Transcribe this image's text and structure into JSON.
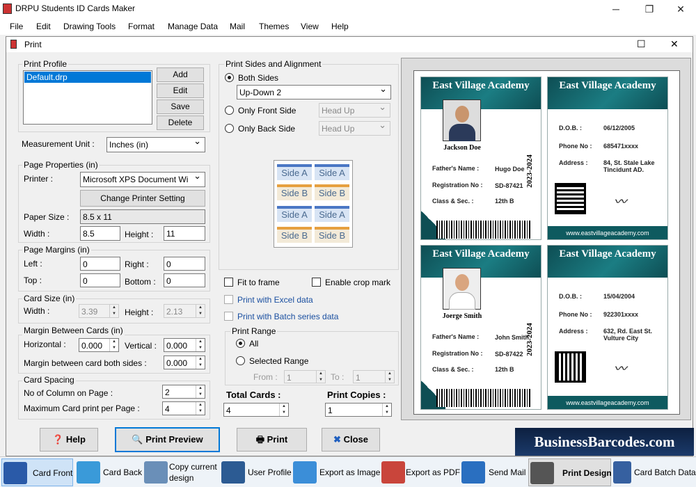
{
  "app": {
    "title": "DRPU Students ID Cards Maker",
    "minimize": "─",
    "maximize": "❐",
    "close": "✕"
  },
  "menu": [
    "File",
    "Edit",
    "Drawing Tools",
    "Format",
    "Manage Data",
    "Mail",
    "Themes",
    "View",
    "Help"
  ],
  "dialog": {
    "title": "Print",
    "maximize": "☐",
    "close": "✕"
  },
  "print_profile": {
    "label": "Print Profile",
    "items": [
      "Default.drp"
    ],
    "buttons": {
      "add": "Add",
      "edit": "Edit",
      "save": "Save",
      "delete": "Delete"
    }
  },
  "measurement": {
    "label": "Measurement Unit :",
    "value": "Inches (in)"
  },
  "page_properties": {
    "label": "Page Properties (in)",
    "printer_label": "Printer :",
    "printer_value": "Microsoft XPS Document Wi",
    "change_printer": "Change Printer Setting",
    "paper_size_label": "Paper Size :",
    "paper_size_value": "8.5 x 11",
    "width_label": "Width :",
    "width_value": "8.5",
    "height_label": "Height :",
    "height_value": "11"
  },
  "page_margins": {
    "label": "Page Margins (in)",
    "left_label": "Left :",
    "left_value": "0",
    "right_label": "Right :",
    "right_value": "0",
    "top_label": "Top :",
    "top_value": "0",
    "bottom_label": "Bottom :",
    "bottom_value": "0"
  },
  "card_size": {
    "label": "Card Size (in)",
    "width_label": "Width :",
    "width_value": "3.39",
    "height_label": "Height :",
    "height_value": "2.13"
  },
  "margin_between": {
    "label": "Margin Between Cards (in)",
    "horizontal_label": "Horizontal :",
    "horizontal_value": "0.000",
    "vertical_label": "Vertical :",
    "vertical_value": "0.000",
    "both_label": "Margin between card both sides :",
    "both_value": "0.000"
  },
  "card_spacing": {
    "label": "Card Spacing",
    "columns_label": "No of Column on Page :",
    "columns_value": "2",
    "max_label": "Maximum Card print per Page :",
    "max_value": "4"
  },
  "print_sides": {
    "label": "Print Sides and Alignment",
    "both": "Both Sides",
    "both_select": "Up-Down 2",
    "front": "Only Front Side",
    "front_select": "Head Up",
    "back": "Only Back Side",
    "back_select": "Head Up",
    "side_a": "Side A",
    "side_b": "Side B"
  },
  "options": {
    "fit_to_frame": "Fit to frame",
    "crop_mark": "Enable crop mark",
    "excel": "Print with Excel data",
    "batch": "Print with Batch series data"
  },
  "print_range": {
    "label": "Print Range",
    "all": "All",
    "selected": "Selected Range",
    "from_label": "From :",
    "from_value": "1",
    "to_label": "To :",
    "to_value": "1"
  },
  "totals": {
    "total_label": "Total Cards :",
    "total_value": "4",
    "copies_label": "Print Copies :",
    "copies_value": "1"
  },
  "buttons": {
    "help": "Help",
    "preview": "Print Preview",
    "print": "Print",
    "close": "Close"
  },
  "watermark": "BusinessBarcodes.com",
  "cards": {
    "school": "East Village Academy",
    "year": "2023-2024",
    "website": "www.eastvillageacademy.com",
    "labels": {
      "father": "Father's Name :",
      "reg": "Registration No :",
      "class": "Class & Sec. :",
      "dob": "D.O.B. :",
      "phone": "Phone No :",
      "address": "Address :"
    },
    "students": [
      {
        "name": "Jackson Doe",
        "father": "Hugo Doe",
        "reg": "SD-87421",
        "class": "12th B",
        "dob": "06/12/2005",
        "phone": "685471xxxx",
        "address": "84, St. Stale Lake Tincidunt AD."
      },
      {
        "name": "Joerge Smith",
        "father": "John Smith",
        "reg": "SD-87422",
        "class": "12th B",
        "dob": "15/04/2004",
        "phone": "922301xxxx",
        "address": "632, Rd. East St. Vulture City"
      }
    ]
  },
  "toolbar": [
    "Card Front",
    "Card Back",
    "Copy current design",
    "User Profile",
    "Export as Image",
    "Export as PDF",
    "Send Mail",
    "Print Design",
    "Card Batch Data"
  ]
}
